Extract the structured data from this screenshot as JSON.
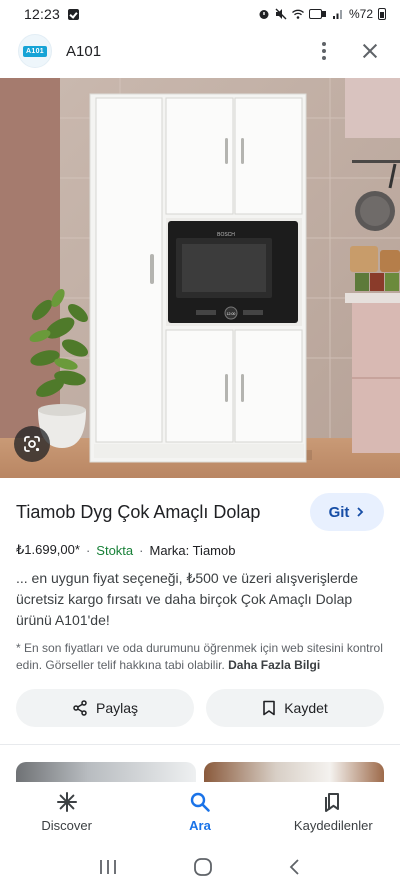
{
  "status_bar": {
    "time": "12:23",
    "battery": "%72"
  },
  "header": {
    "logo_text": "A101",
    "site_name": "A101"
  },
  "product": {
    "title": "Tiamob Dyg Çok Amaçlı Dolap",
    "visit_label": "Git",
    "price": "₺1.699,00*",
    "stock": "Stokta",
    "brand": "Marka: Tiamob",
    "description": "... en uygun fiyat seçeneği, ₺500 ve üzeri alışverişlerde ücretsiz kargo fırsatı ve daha birçok Çok Amaçlı Dolap ürünü A101'de!",
    "note": "* En son fiyatları ve oda durumunu öğrenmek için web sitesini kontrol edin. Görseller telif hakkına tabi olabilir.",
    "note_more": "Daha Fazla Bilgi",
    "oven_brand": "BOSCH",
    "oven_time": "12:00"
  },
  "actions": {
    "share_label": "Paylaş",
    "save_label": "Kaydet"
  },
  "bottom_nav": {
    "items": [
      {
        "label": "Discover",
        "icon": "asterisk-icon"
      },
      {
        "label": "Ara",
        "icon": "search-icon"
      },
      {
        "label": "Kaydedilenler",
        "icon": "bookmarks-icon"
      }
    ],
    "active": "Ara"
  },
  "colors": {
    "accent": "#1a73e8",
    "stock_green": "#188038",
    "pill_bg": "#f1f3f4",
    "visit_bg": "#e8f0fe"
  }
}
